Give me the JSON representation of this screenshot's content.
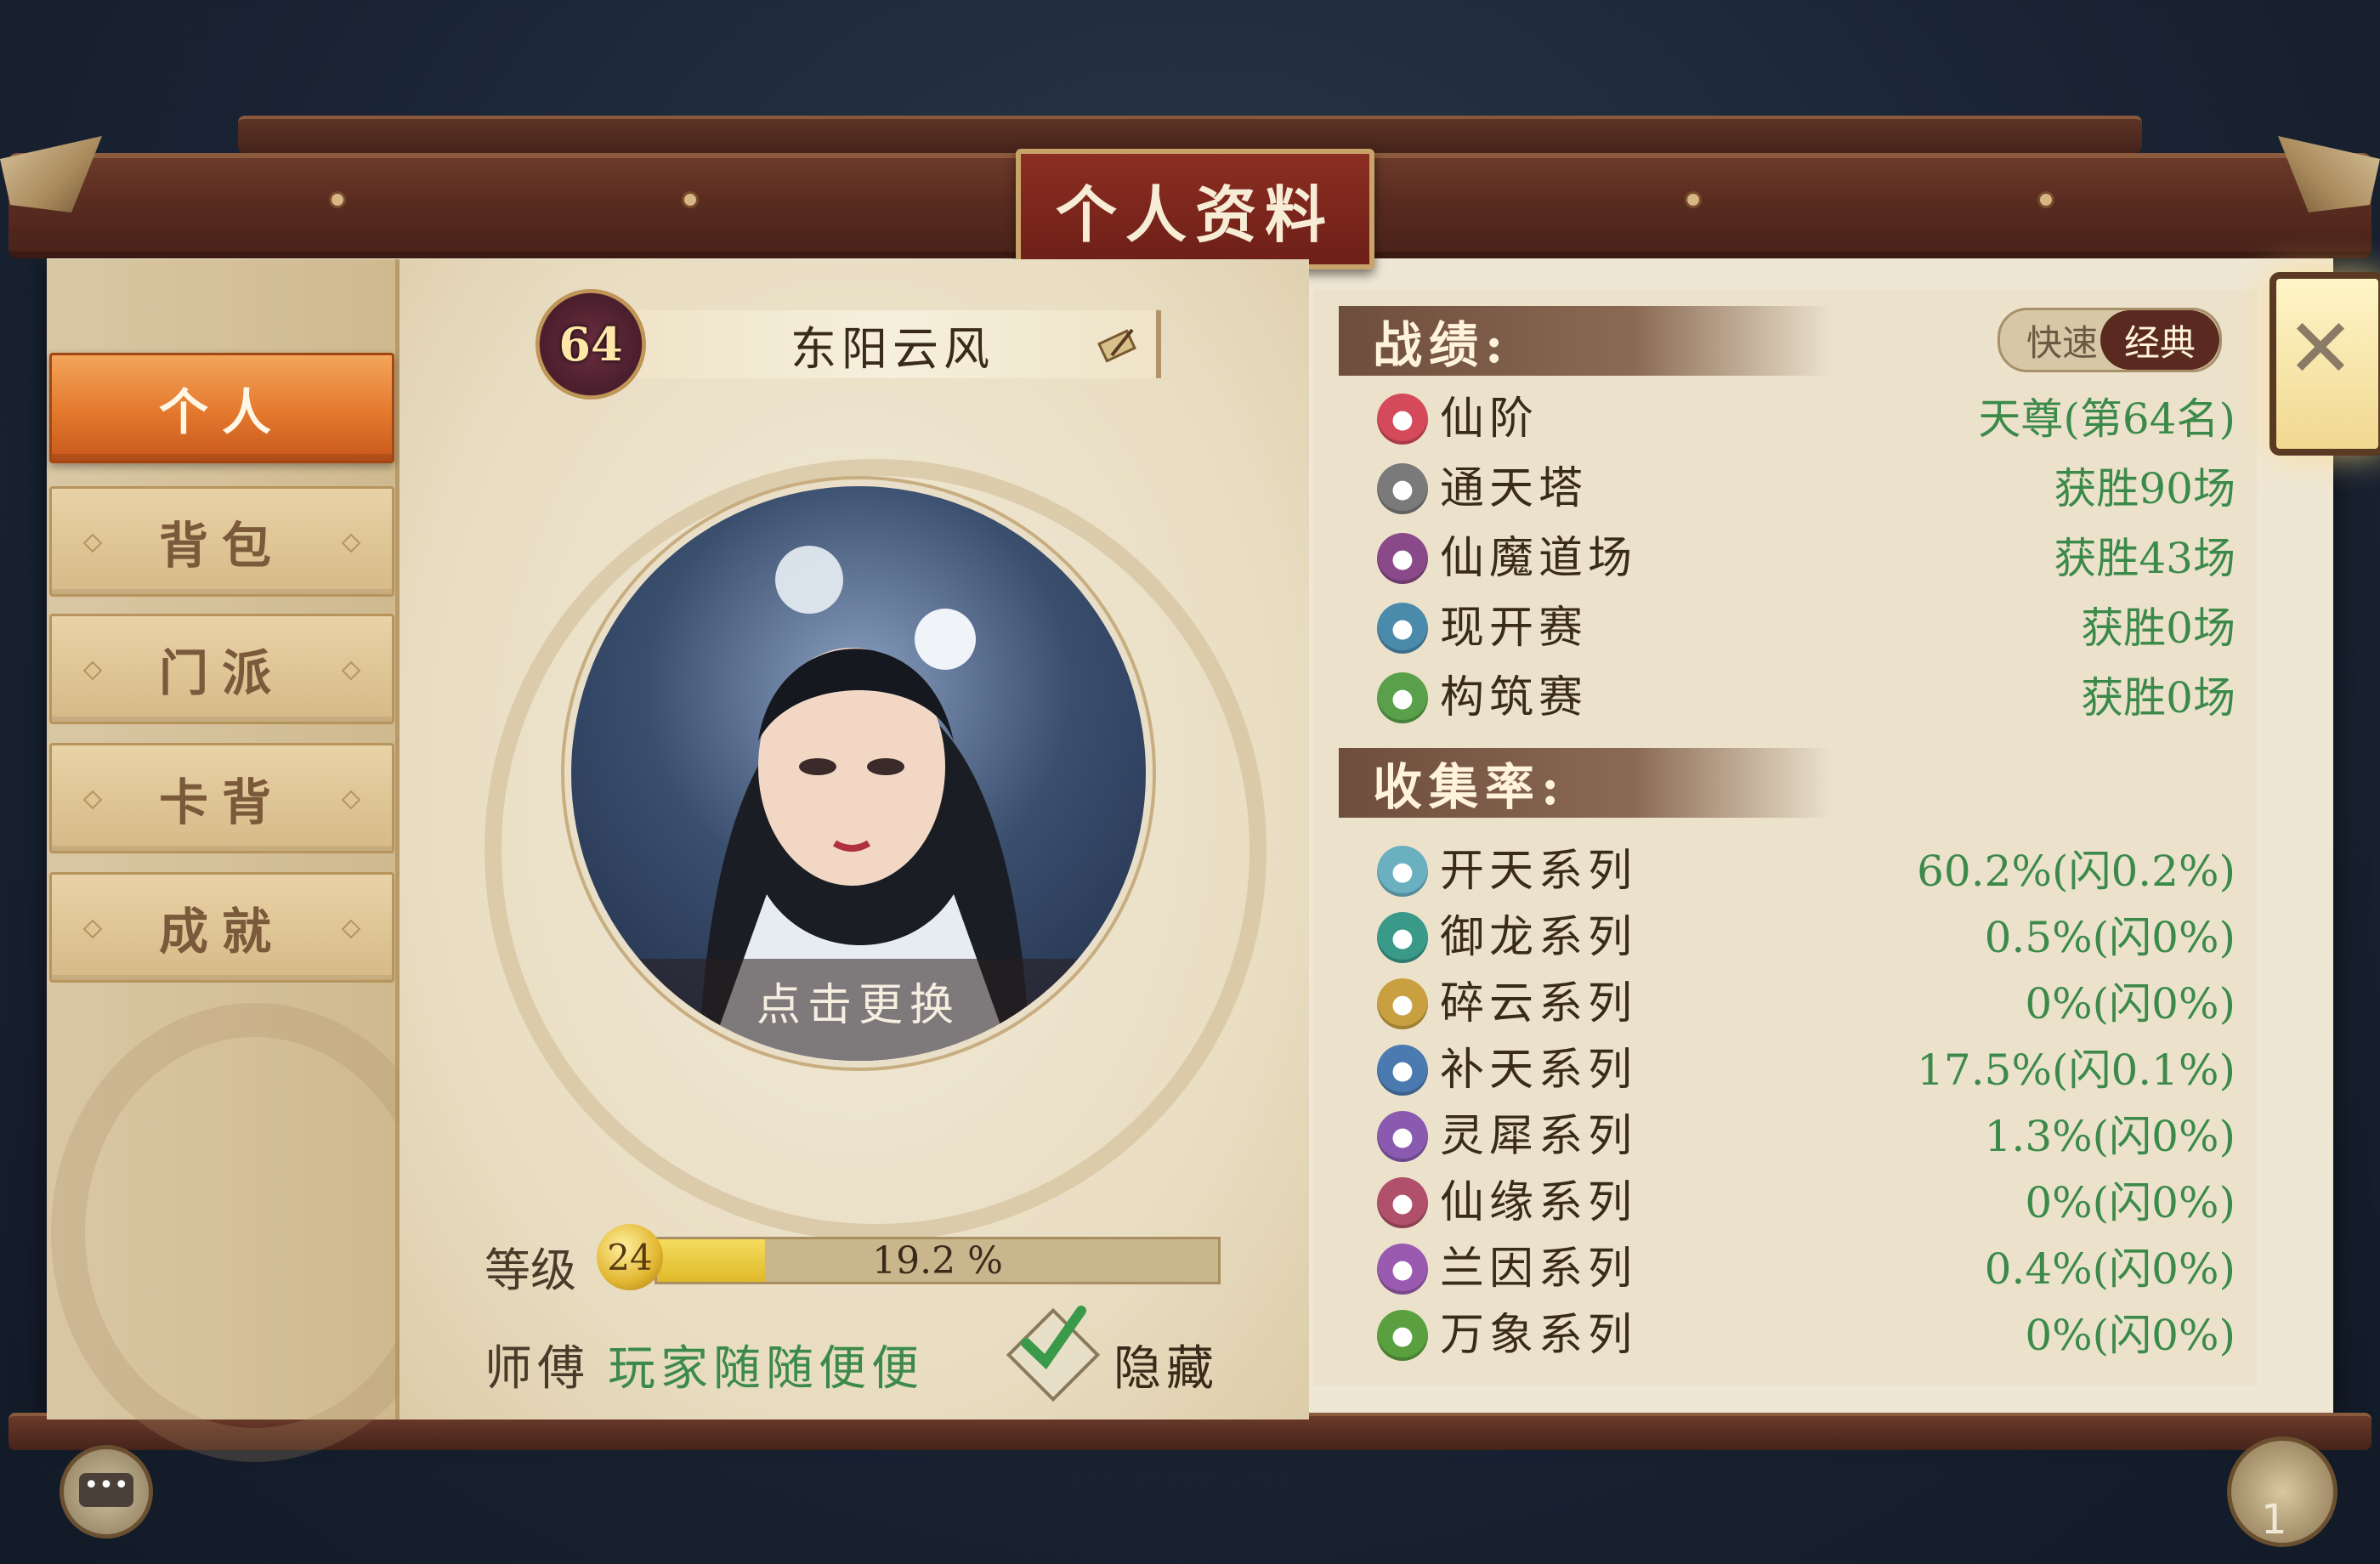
{
  "title": "个人资料",
  "sidebar": {
    "tabs": [
      {
        "label": "个人",
        "active": true
      },
      {
        "label": "背包",
        "active": false
      },
      {
        "label": "门派",
        "active": false
      },
      {
        "label": "卡背",
        "active": false
      },
      {
        "label": "成就",
        "active": false
      }
    ]
  },
  "profile": {
    "level_badge": "64",
    "name": "东阳云风",
    "avatar_change_label": "点击更换",
    "level_label": "等级",
    "level": "24",
    "level_progress_text": "19.2 %",
    "level_progress": 0.192,
    "master_label": "师傅",
    "master_name": "玩家随随便便",
    "hide_label": "隐藏",
    "hide_checked": true
  },
  "record": {
    "header": "战绩:",
    "toggle": {
      "off_label": "快速",
      "on_label": "经典"
    },
    "rows": [
      {
        "icon": "star-icon",
        "label": "仙阶",
        "value": "天尊(第64名)",
        "color": "#d44a5a"
      },
      {
        "icon": "tower-icon",
        "label": "通天塔",
        "value": "获胜90场",
        "color": "#7a7a7a"
      },
      {
        "icon": "bird-icon",
        "label": "仙魔道场",
        "value": "获胜43场",
        "color": "#8a4a8a"
      },
      {
        "icon": "gear-icon",
        "label": "现开赛",
        "value": "获胜0场",
        "color": "#4a8aaa"
      },
      {
        "icon": "leaf-icon",
        "label": "构筑赛",
        "value": "获胜0场",
        "color": "#5aa04a"
      }
    ]
  },
  "collection": {
    "header": "收集率:",
    "rows": [
      {
        "icon": "sword-icon",
        "label": "开天系列",
        "value": "60.2%(闪0.2%)",
        "color": "#6ab0c0"
      },
      {
        "icon": "dragon-icon",
        "label": "御龙系列",
        "value": "0.5%(闪0%)",
        "color": "#3a9a8a"
      },
      {
        "icon": "cloud-icon",
        "label": "碎云系列",
        "value": "0%(闪0%)",
        "color": "#c8a040"
      },
      {
        "icon": "sky-icon",
        "label": "补天系列",
        "value": "17.5%(闪0.1%)",
        "color": "#4a7ab0"
      },
      {
        "icon": "rhino-icon",
        "label": "灵犀系列",
        "value": "1.3%(闪0%)",
        "color": "#8a5ab0"
      },
      {
        "icon": "feather-icon",
        "label": "仙缘系列",
        "value": "0%(闪0%)",
        "color": "#b0506a"
      },
      {
        "icon": "orchid-icon",
        "label": "兰因系列",
        "value": "0.4%(闪0%)",
        "color": "#9a5ab0"
      },
      {
        "icon": "sprout-icon",
        "label": "万象系列",
        "value": "0%(闪0%)",
        "color": "#5aa040"
      }
    ]
  },
  "bottom": {
    "chat_icon_text": "•••",
    "friend_count": "1"
  }
}
